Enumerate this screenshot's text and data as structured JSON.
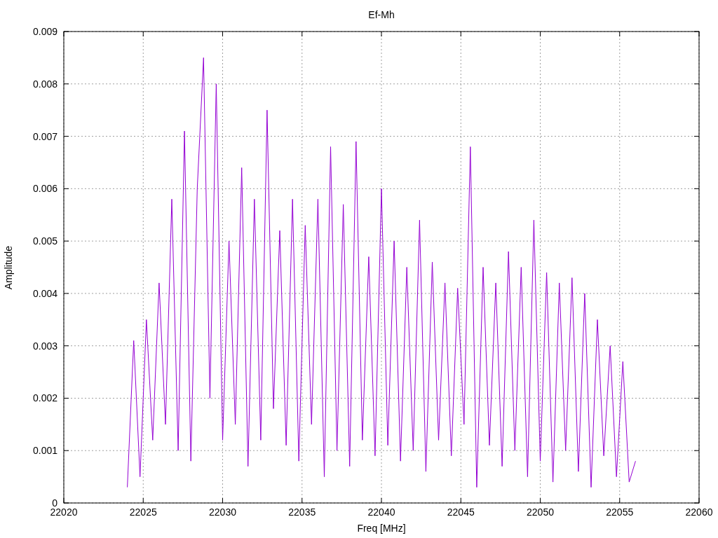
{
  "chart_data": {
    "type": "line",
    "title": "Ef-Mh",
    "xlabel": "Freq [MHz]",
    "ylabel": "Amplitude",
    "xlim": [
      22020,
      22060
    ],
    "ylim": [
      0,
      0.009
    ],
    "xticks": [
      22020,
      22025,
      22030,
      22035,
      22040,
      22045,
      22050,
      22055,
      22060
    ],
    "yticks": [
      0,
      0.001,
      0.002,
      0.003,
      0.004,
      0.005,
      0.006,
      0.007,
      0.008,
      0.009
    ],
    "x": [
      22024,
      22024.4,
      22024.8,
      22025.2,
      22025.6,
      22026,
      22026.4,
      22026.8,
      22027.2,
      22027.6,
      22028,
      22028.4,
      22028.8,
      22029.2,
      22029.6,
      22030,
      22030.4,
      22030.8,
      22031.2,
      22031.6,
      22032,
      22032.4,
      22032.8,
      22033.2,
      22033.6,
      22034,
      22034.4,
      22034.8,
      22035.2,
      22035.6,
      22036,
      22036.4,
      22036.8,
      22037.2,
      22037.6,
      22038,
      22038.4,
      22038.8,
      22039.2,
      22039.6,
      22040,
      22040.4,
      22040.8,
      22041.2,
      22041.6,
      22042,
      22042.4,
      22042.8,
      22043.2,
      22043.6,
      22044,
      22044.4,
      22044.8,
      22045.2,
      22045.6,
      22046,
      22046.4,
      22046.8,
      22047.2,
      22047.6,
      22048,
      22048.4,
      22048.8,
      22049.2,
      22049.6,
      22050,
      22050.4,
      22050.8,
      22051.2,
      22051.6,
      22052,
      22052.4,
      22052.8,
      22053.2,
      22053.6,
      22054,
      22054.4,
      22054.8,
      22055.2,
      22055.6,
      22056
    ],
    "grid": true,
    "series": [
      {
        "color": "#9400d3",
        "values": [
          0.0003,
          0.0031,
          0.0005,
          0.0035,
          0.0012,
          0.0042,
          0.0015,
          0.0058,
          0.001,
          0.0071,
          0.0008,
          0.006,
          0.0085,
          0.002,
          0.008,
          0.0012,
          0.005,
          0.0015,
          0.0064,
          0.0007,
          0.0058,
          0.0012,
          0.0075,
          0.0018,
          0.0052,
          0.0011,
          0.0058,
          0.0008,
          0.0053,
          0.0015,
          0.0058,
          0.0005,
          0.0068,
          0.001,
          0.0057,
          0.0007,
          0.0069,
          0.0012,
          0.0047,
          0.0009,
          0.006,
          0.0011,
          0.005,
          0.0008,
          0.0045,
          0.001,
          0.0054,
          0.0006,
          0.0046,
          0.0012,
          0.0042,
          0.0009,
          0.0041,
          0.0015,
          0.0068,
          0.0003,
          0.0045,
          0.0011,
          0.0042,
          0.0007,
          0.0048,
          0.001,
          0.0045,
          0.0005,
          0.0054,
          0.0008,
          0.0044,
          0.0004,
          0.0042,
          0.001,
          0.0043,
          0.0006,
          0.004,
          0.0003,
          0.0035,
          0.0009,
          0.003,
          0.0005,
          0.0027,
          0.0004,
          0.0008
        ]
      }
    ]
  }
}
